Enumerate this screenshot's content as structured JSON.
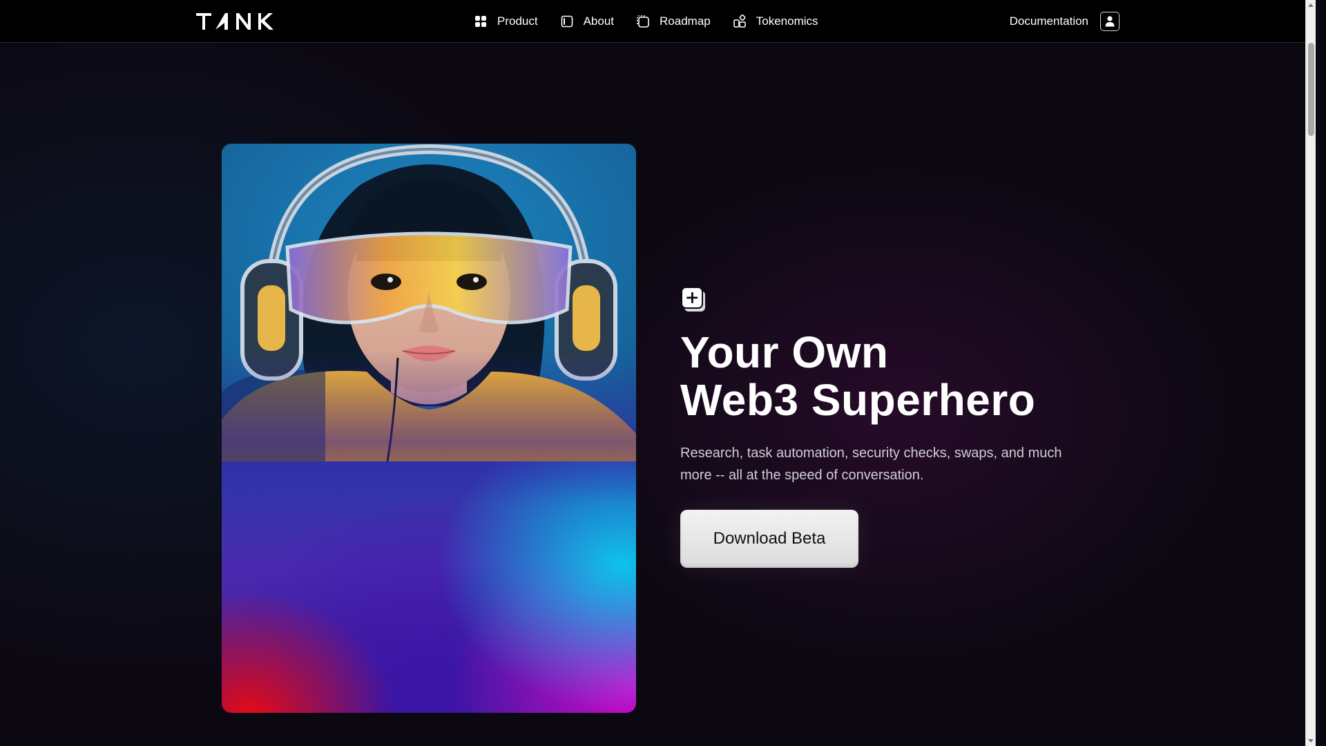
{
  "nav": {
    "logo": "TANK",
    "links": [
      {
        "label": "Product",
        "icon": "grid-icon"
      },
      {
        "label": "About",
        "icon": "panel-icon"
      },
      {
        "label": "Roadmap",
        "icon": "path-icon"
      },
      {
        "label": "Tokenomics",
        "icon": "blocks-icon"
      }
    ],
    "documentation": "Documentation",
    "user_icon": "user-icon"
  },
  "hero": {
    "image_subject": "portrait of a girl with headphones and tinted glasses",
    "badge_icon": "add-layer-icon",
    "headline_line1": "Your Own",
    "headline_line2": "Web3 Superhero",
    "subtext": "Research, task automation, security checks, swaps, and much more -- all at the speed of conversation.",
    "cta_label": "Download Beta"
  },
  "colors": {
    "nav_bg": "#000000",
    "page_bg": "#0c0812",
    "cta_bg": "#e6e6e6",
    "text_muted": "#cfcfd4"
  }
}
